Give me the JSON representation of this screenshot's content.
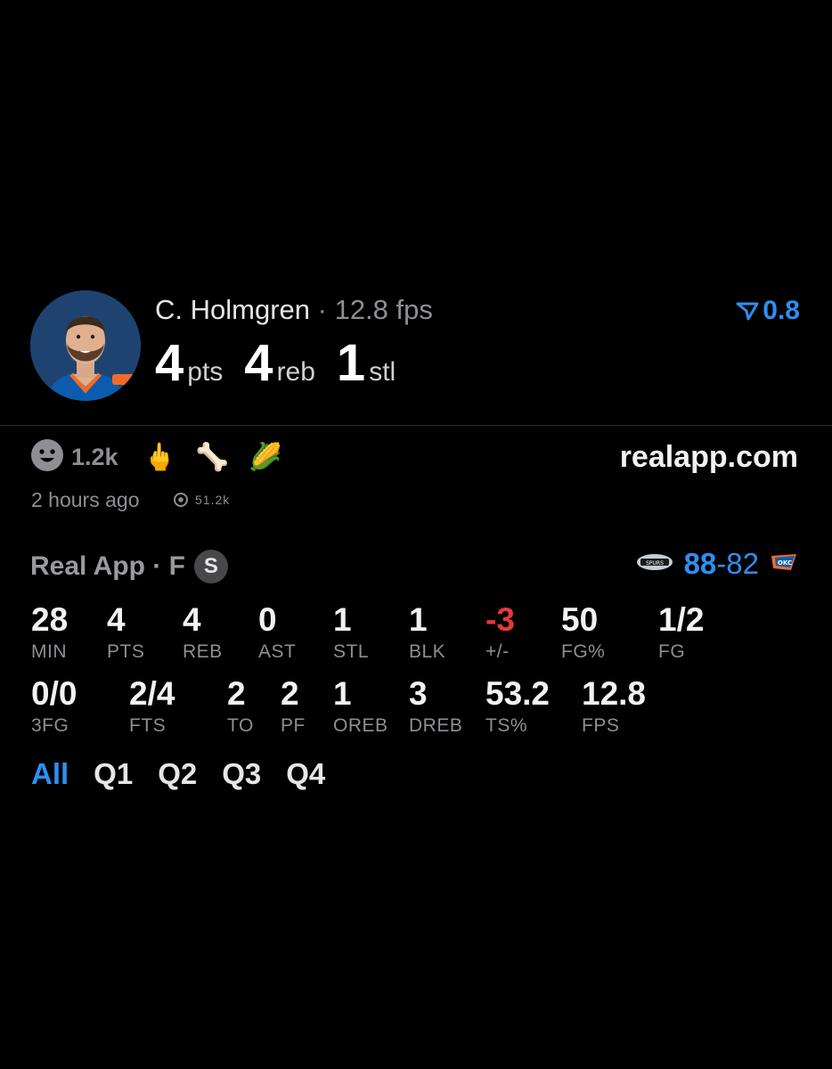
{
  "player": {
    "name": "C. Holmgren",
    "separator": "·",
    "fps": "12.8 fps",
    "headline": [
      {
        "value": "4",
        "unit": "pts"
      },
      {
        "value": "4",
        "unit": "reb"
      },
      {
        "value": "1",
        "unit": "stl"
      }
    ],
    "boost_value": "0.8"
  },
  "reactions": {
    "count": "1.2k",
    "emojis": [
      "🖕",
      "🦴",
      "🌽"
    ],
    "site": "realapp.com",
    "timestamp": "2 hours ago",
    "views": "51.2k"
  },
  "game": {
    "label": "Real App · F",
    "badge": "S",
    "score_left": "88",
    "score_sep": "-",
    "score_right": "82"
  },
  "stats": {
    "row1": [
      {
        "value": "28",
        "label": "MIN"
      },
      {
        "value": "4",
        "label": "PTS"
      },
      {
        "value": "4",
        "label": "REB"
      },
      {
        "value": "0",
        "label": "AST"
      },
      {
        "value": "1",
        "label": "STL"
      },
      {
        "value": "1",
        "label": "BLK"
      },
      {
        "value": "-3",
        "label": "+/-"
      },
      {
        "value": "50",
        "label": "FG%"
      },
      {
        "value": "1/2",
        "label": "FG"
      }
    ],
    "row2": [
      {
        "value": "0/0",
        "label": "3FG"
      },
      {
        "value": "2/4",
        "label": "FTS"
      },
      {
        "value": "2",
        "label": "TO"
      },
      {
        "value": "2",
        "label": "PF"
      },
      {
        "value": "1",
        "label": "OREB"
      },
      {
        "value": "3",
        "label": "DREB"
      },
      {
        "value": "53.2",
        "label": "TS%"
      },
      {
        "value": "12.8",
        "label": "FPS"
      }
    ]
  },
  "tabs": [
    "All",
    "Q1",
    "Q2",
    "Q3",
    "Q4"
  ],
  "colors": {
    "accent": "#2f8ef0",
    "negative": "#e5393b",
    "muted": "#8e8e93",
    "background": "#000000"
  }
}
